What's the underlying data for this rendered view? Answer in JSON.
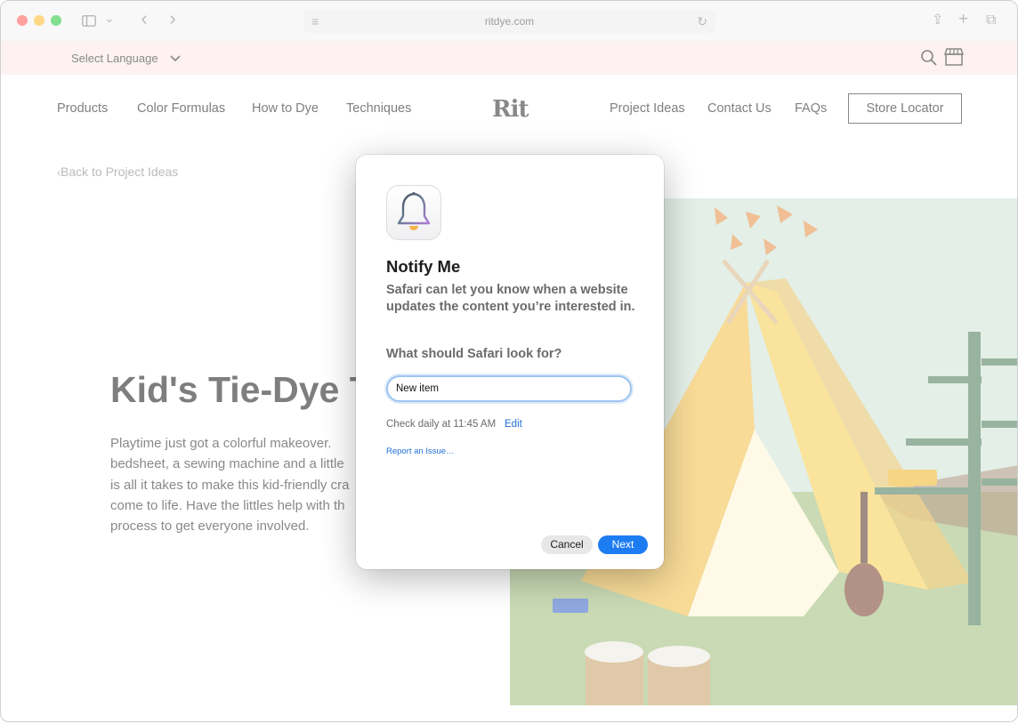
{
  "browser": {
    "url": "ritdye.com",
    "sidebar_chevron": "⌄",
    "back": "‹",
    "forward": "›",
    "reader_glyph": "≡",
    "reload_glyph": "↻",
    "share_glyph": "⇪",
    "new_tab_glyph": "+",
    "tabs_glyph": "⧉"
  },
  "topbar": {
    "language": "Select Language"
  },
  "nav": {
    "items": [
      "Products",
      "Color Formulas",
      "How to Dye",
      "Techniques",
      "Project Ideas",
      "Contact Us",
      "FAQs"
    ],
    "logo": "Rit",
    "store_locator": "Store Locator"
  },
  "page": {
    "back_link": "Back to Project Ideas",
    "title": "Kid's Tie-Dye T",
    "body_lines": [
      "Playtime just got a colorful makeover.",
      "bedsheet, a sewing machine and a little",
      "is all it takes to make this kid-friendly cra",
      "come to life. Have the littles help with th",
      "process to get everyone involved."
    ]
  },
  "dialog": {
    "title": "Notify Me",
    "description": "Safari can let you know when a website updates the content you’re interested in.",
    "question": "What should Safari look for?",
    "input_value": "New item",
    "check_text": "Check daily at 11:45 AM",
    "edit": "Edit",
    "report": "Report an Issue…",
    "cancel": "Cancel",
    "next": "Next"
  },
  "colors": {
    "accent": "#1e7cf2",
    "lang_bar": "#fbe7e7"
  }
}
